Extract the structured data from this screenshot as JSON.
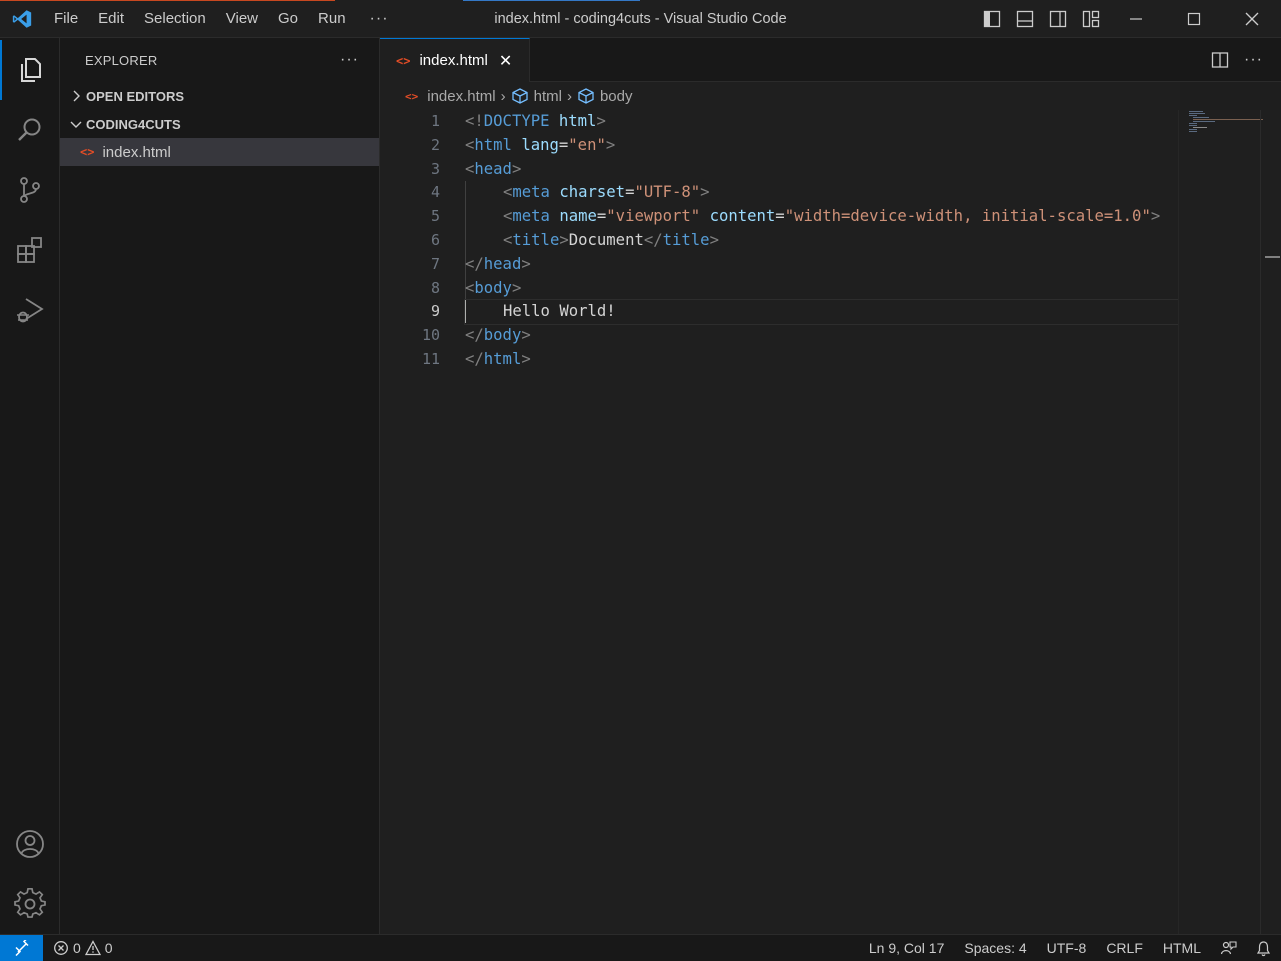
{
  "window": {
    "title": "index.html - coding4cuts - Visual Studio Code"
  },
  "menu": {
    "items": [
      "File",
      "Edit",
      "Selection",
      "View",
      "Go",
      "Run"
    ],
    "more": "···"
  },
  "activity_bar": {
    "items": [
      "explorer-icon",
      "search-icon",
      "source-control-icon",
      "extensions-icon",
      "run-debug-icon"
    ],
    "bottom": [
      "account-icon",
      "settings-gear-icon"
    ]
  },
  "sidebar": {
    "title": "EXPLORER",
    "more": "···",
    "sections": [
      {
        "label": "OPEN EDITORS",
        "expanded": false
      },
      {
        "label": "CODING4CUTS",
        "expanded": true
      }
    ],
    "files": [
      {
        "name": "index.html",
        "icon": "html-file-icon"
      }
    ]
  },
  "editor": {
    "tab": {
      "label": "index.html",
      "close": "✕"
    },
    "breadcrumb": [
      "index.html",
      "html",
      "body"
    ],
    "active_line": 9,
    "line_numbers": [
      "1",
      "2",
      "3",
      "4",
      "5",
      "6",
      "7",
      "8",
      "9",
      "10",
      "11"
    ],
    "code": {
      "l1": {
        "open": "<!",
        "doctype": "DOCTYPE",
        "sp": " ",
        "html": "html",
        "close": ">"
      },
      "l2": {
        "open": "<",
        "tag": "html",
        "sp": " ",
        "attr": "lang",
        "eq": "=",
        "val": "\"en\"",
        "close": ">"
      },
      "l3": {
        "open": "<",
        "tag": "head",
        "close": ">"
      },
      "l4": {
        "open": "<",
        "tag": "meta",
        "sp": " ",
        "attr": "charset",
        "eq": "=",
        "val": "\"UTF-8\"",
        "close": ">"
      },
      "l5": {
        "open": "<",
        "tag": "meta",
        "sp": " ",
        "attr1": "name",
        "eq1": "=",
        "val1": "\"viewport\"",
        "sp2": " ",
        "attr2": "content",
        "eq2": "=",
        "val2": "\"width=device-width, initial-scale=1.0\"",
        "close": ">"
      },
      "l6": {
        "open": "<",
        "tag": "title",
        "close": ">",
        "text": "Document",
        "open2": "</",
        "tag2": "title",
        "close2": ">"
      },
      "l7": {
        "open": "</",
        "tag": "head",
        "close": ">"
      },
      "l8": {
        "open": "<",
        "tag": "body",
        "close": ">"
      },
      "l9": {
        "text": "Hello World!"
      },
      "l10": {
        "open": "</",
        "tag": "body",
        "close": ">"
      },
      "l11": {
        "open": "</",
        "tag": "html",
        "close": ">"
      }
    }
  },
  "status_bar": {
    "errors": "0",
    "warnings": "0",
    "position": "Ln 9, Col 17",
    "spaces": "Spaces: 4",
    "encoding": "UTF-8",
    "eol": "CRLF",
    "language": "HTML"
  },
  "colors": {
    "accent": "#0078d4",
    "html_icon": "#e44d26",
    "tag": "#569cd6",
    "attribute": "#9cdcfe",
    "string": "#ce9178"
  }
}
